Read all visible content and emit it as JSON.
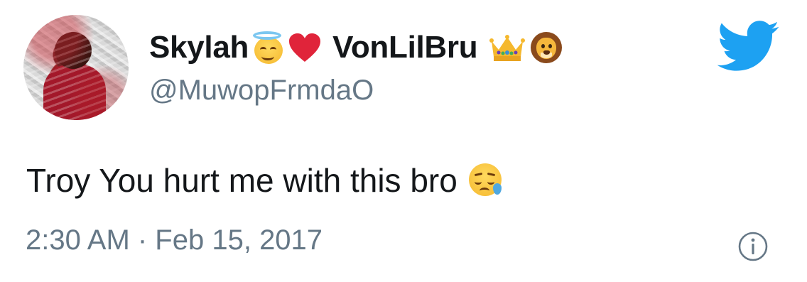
{
  "tweet": {
    "display_name_first": "Skylah",
    "display_name_second": "VonLilBru",
    "name_emojis": [
      "smiling-face-with-halo-icon",
      "red-heart-icon",
      "crown-icon",
      "lion-face-icon"
    ],
    "handle": "@MuwopFrmdaO",
    "text": "Troy You hurt me with this bro",
    "text_emoji": "sleepy-face-icon",
    "timestamp": "2:30 AM · Feb 15, 2017"
  },
  "icons": {
    "brand": "twitter-bird-icon",
    "info": "info-icon"
  },
  "colors": {
    "twitter_blue": "#1da1f2",
    "text_primary": "#14171a",
    "text_secondary": "#657786",
    "heart_red": "#e0243a",
    "background": "#ffffff"
  }
}
